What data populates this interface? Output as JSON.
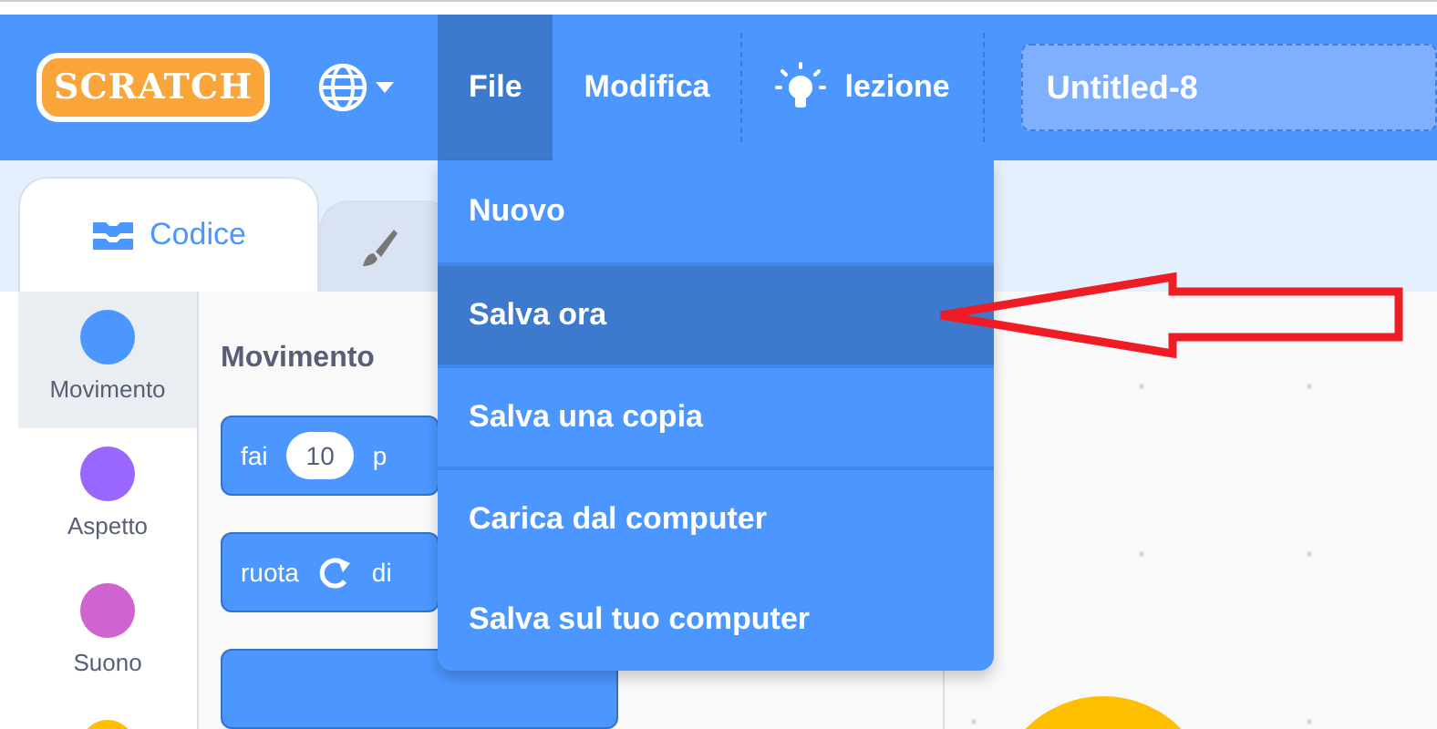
{
  "header": {
    "logo": "SCRATCH",
    "menus": [
      {
        "label": "File",
        "selected": true
      },
      {
        "label": "Modifica",
        "selected": false
      }
    ],
    "tutorial": {
      "label": "lezione"
    },
    "project_title": {
      "value": "Untitled-8"
    }
  },
  "tabs": [
    {
      "kind": "code",
      "label": "Codice",
      "selected": true
    },
    {
      "kind": "costumes",
      "selected": false
    }
  ],
  "categories": [
    {
      "label": "Movimento",
      "color": "#4c97ff",
      "selected": true
    },
    {
      "label": "Aspetto",
      "color": "#9966ff",
      "selected": false
    },
    {
      "label": "Suono",
      "color": "#cf63cf",
      "selected": false
    },
    {
      "color": "#ffbf00",
      "selected": false
    }
  ],
  "palette": {
    "heading": "Movimento",
    "blocks": [
      {
        "parts": [
          {
            "kind": "text",
            "text": "fai"
          },
          {
            "kind": "input",
            "text": "10"
          },
          {
            "kind": "text",
            "text": "p"
          }
        ]
      },
      {
        "parts": [
          {
            "kind": "text",
            "text": "ruota"
          },
          {
            "kind": "turn-icon"
          },
          {
            "kind": "text",
            "text": "di"
          }
        ]
      },
      {
        "kind": "cut-off"
      }
    ]
  },
  "file_menu": [
    {
      "label": "Nuovo",
      "selected": false,
      "divider_above": false
    },
    {
      "label": "Salva ora",
      "selected": true,
      "divider_above": true
    },
    {
      "label": "Salva una copia",
      "selected": false,
      "divider_above": true
    },
    {
      "label": "Carica dal computer",
      "selected": false,
      "divider_above": true
    },
    {
      "label": "Salva sul tuo computer",
      "selected": false,
      "divider_above": false
    }
  ]
}
